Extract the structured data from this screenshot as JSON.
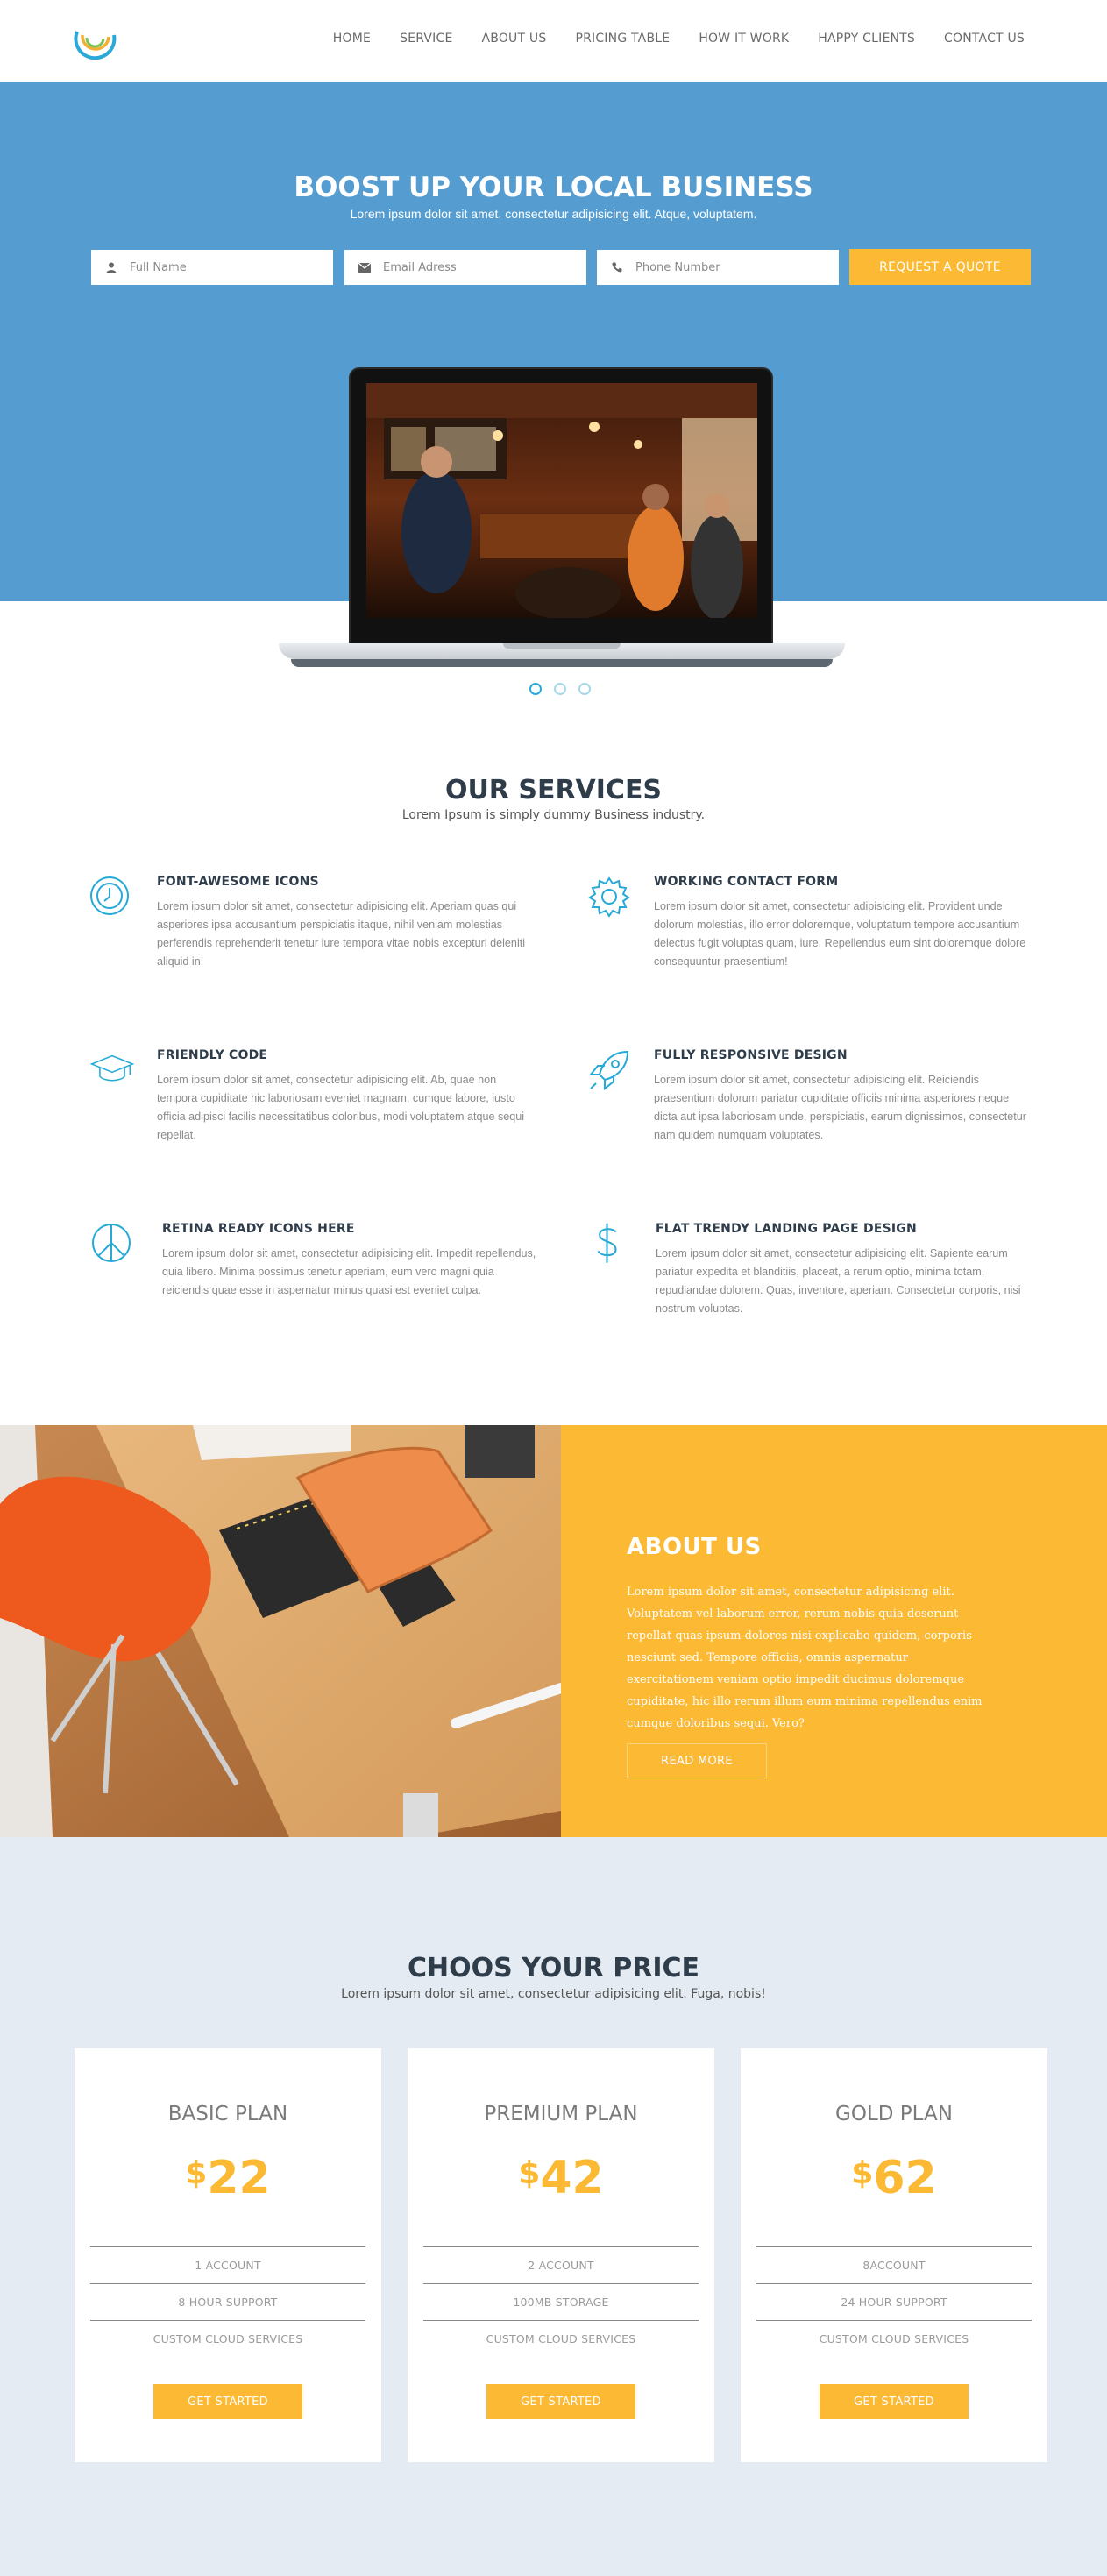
{
  "brand": {
    "logo_icon": "spiral-rings-logo-icon"
  },
  "nav": {
    "items": [
      {
        "label": "HOME"
      },
      {
        "label": "SERVICE"
      },
      {
        "label": "ABOUT US"
      },
      {
        "label": "PRICING TABLE"
      },
      {
        "label": "HOW IT WORK"
      },
      {
        "label": "HAPPY CLIENTS"
      },
      {
        "label": "CONTACT US"
      }
    ]
  },
  "hero": {
    "title": "BOOST UP YOUR LOCAL BUSINESS",
    "subtitle": "Lorem ipsum dolor sit amet, consectetur adipisicing elit. Atque, voluptatem.",
    "fields": {
      "name": {
        "placeholder": "Full Name",
        "icon": "user-icon"
      },
      "email": {
        "placeholder": "Email Adress",
        "icon": "envelope-icon"
      },
      "phone": {
        "placeholder": "Phone Number",
        "icon": "phone-icon"
      }
    },
    "cta": "REQUEST A QUOTE",
    "slider": {
      "slides": 3,
      "active": 1
    }
  },
  "services": {
    "title": "OUR SERVICES",
    "subtitle": "Lorem Ipsum is simply dummy Business industry.",
    "items": [
      {
        "icon": "clock-icon",
        "title": "FONT-AWESOME ICONS",
        "text": "Lorem ipsum dolor sit amet, consectetur adipisicing elit. Aperiam quas qui asperiores ipsa accusantium perspiciatis itaque, nihil veniam molestias perferendis reprehenderit tenetur iure tempora vitae nobis excepturi deleniti aliquid in!"
      },
      {
        "icon": "gear-icon",
        "title": "WORKING CONTACT FORM",
        "text": "Lorem ipsum dolor sit amet, consectetur adipisicing elit. Provident unde dolorum molestias, illo error doloremque, voluptatum tempore accusantium delectus fugit voluptas quam, iure. Repellendus eum sint doloremque dolore consequuntur praesentium!"
      },
      {
        "icon": "graduation-cap-icon",
        "title": "FRIENDLY CODE",
        "text": "Lorem ipsum dolor sit amet, consectetur adipisicing elit. Ab, quae non tempora cupiditate hic laboriosam eveniet magnam, cumque labore, iusto officia adipisci facilis necessitatibus doloribus, modi voluptatem atque sequi repellat."
      },
      {
        "icon": "rocket-icon",
        "title": "FULLY RESPONSIVE DESIGN",
        "text": "Lorem ipsum dolor sit amet, consectetur adipisicing elit. Reiciendis praesentium dolorum pariatur cupiditate officiis minima asperiores neque dicta aut ipsa laboriosam unde, perspiciatis, earum dignissimos, consectetur nam quidem numquam voluptates."
      },
      {
        "icon": "peace-icon",
        "title": "RETINA READY ICONS HERE",
        "text": "Lorem ipsum dolor sit amet, consectetur adipisicing elit. Impedit repellendus, quia libero. Minima possimus tenetur aperiam, eum vero magni quia reiciendis quae esse in aspernatur minus quasi est eveniet culpa."
      },
      {
        "icon": "dollar-icon",
        "title": "FLAT TRENDY LANDING PAGE DESIGN",
        "text": "Lorem ipsum dolor sit amet, consectetur adipisicing elit. Sapiente earum pariatur expedita et blanditiis, placeat, a rerum optio, minima totam, repudiandae dolorem. Quas, inventore, aperiam. Consectetur corporis, nisi nostrum voluptas."
      }
    ]
  },
  "about": {
    "title": "ABOUT US",
    "text": "Lorem ipsum dolor sit amet, consectetur adipisicing elit. Voluptatem vel laborum error, rerum nobis quia deserunt repellat quas ipsum dolores nisi explicabo quidem, corporis nesciunt sed. Tempore officiis, omnis aspernatur exercitationem veniam optio impedit ducimus doloremque cupiditate, hic illo rerum illum eum minima repellendus enim cumque doloribus sequi. Vero?",
    "button": "READ MORE"
  },
  "pricing": {
    "title": "CHOOS YOUR PRICE",
    "subtitle": "Lorem ipsum dolor sit amet, consectetur adipisicing elit. Fuga, nobis!",
    "currency": "$",
    "plans": [
      {
        "name": "BASIC PLAN",
        "price": "22",
        "features": [
          "1 ACCOUNT",
          "8 HOUR SUPPORT",
          "CUSTOM CLOUD SERVICES"
        ],
        "button": "GET STARTED"
      },
      {
        "name": "PREMIUM PLAN",
        "price": "42",
        "features": [
          "2 ACCOUNT",
          "100MB STORAGE",
          "CUSTOM CLOUD SERVICES"
        ],
        "button": "GET STARTED"
      },
      {
        "name": "GOLD PLAN",
        "price": "62",
        "features": [
          "8ACCOUNT",
          "24 HOUR SUPPORT",
          "CUSTOM CLOUD SERVICES"
        ],
        "button": "GET STARTED"
      }
    ]
  },
  "colors": {
    "hero_blue": "#559dd0",
    "accent_yellow": "#fcb934",
    "icon_teal": "#27a9d6",
    "dark_heading": "#2f3c4a",
    "pricing_bg": "#e4ebf2"
  }
}
